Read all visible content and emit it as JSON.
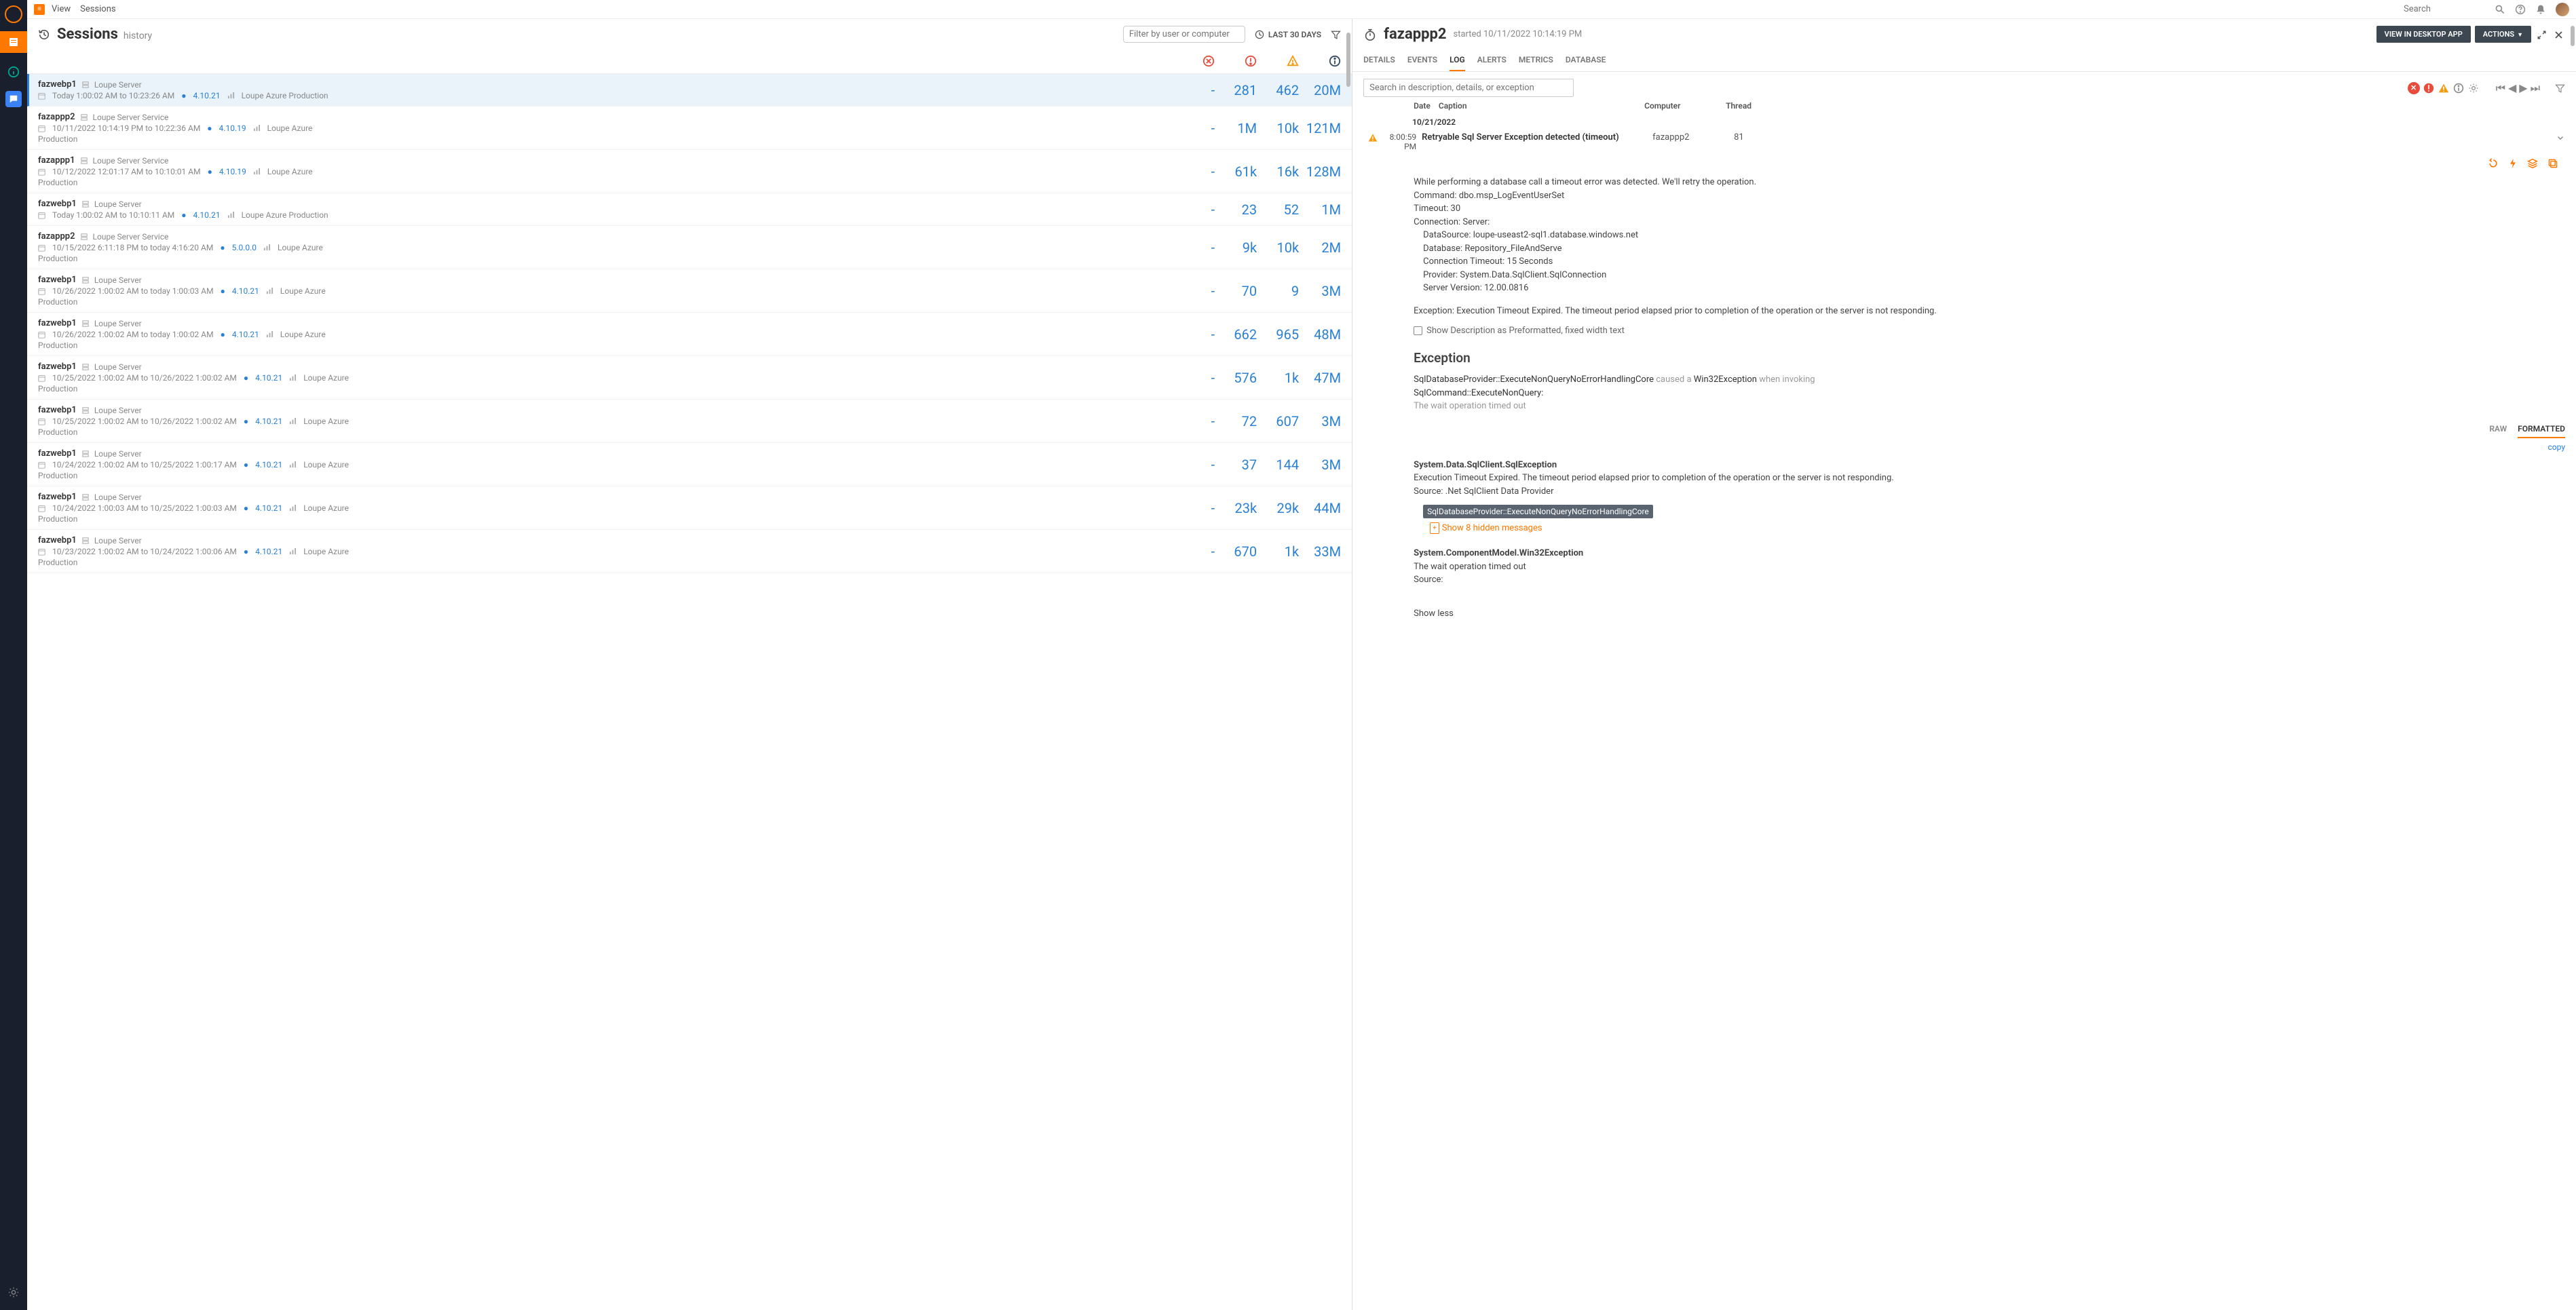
{
  "topbar": {
    "menu": [
      "View",
      "Sessions"
    ],
    "search_placeholder": "Search"
  },
  "sessions_header": {
    "title": "Sessions",
    "subtitle": "history",
    "filter_placeholder": "Filter by user or computer",
    "timerange": "LAST 30 DAYS"
  },
  "sessions": [
    {
      "host": "fazwebp1",
      "app": "Loupe Server",
      "time": "Today 1:00:02 AM to 10:23:26 AM",
      "version": "4.10.21",
      "env": "Loupe Azure Production",
      "c1": "-",
      "c2": "281",
      "c3": "462",
      "c4": "20M",
      "selected": true,
      "wrap": false
    },
    {
      "host": "fazappp2",
      "app": "Loupe Server Service",
      "time": "10/11/2022 10:14:19 PM to 10:22:36 AM",
      "version": "4.10.19",
      "env": "Loupe Azure",
      "extra": "Production",
      "c1": "-",
      "c2": "1M",
      "c3": "10k",
      "c4": "121M",
      "wrap": true
    },
    {
      "host": "fazappp1",
      "app": "Loupe Server Service",
      "time": "10/12/2022 12:01:17 AM to 10:10:01 AM",
      "version": "4.10.19",
      "env": "Loupe Azure",
      "extra": "Production",
      "c1": "-",
      "c2": "61k",
      "c3": "16k",
      "c4": "128M",
      "wrap": true
    },
    {
      "host": "fazwebp1",
      "app": "Loupe Server",
      "time": "Today 1:00:02 AM to 10:10:11 AM",
      "version": "4.10.21",
      "env": "Loupe Azure Production",
      "c1": "-",
      "c2": "23",
      "c3": "52",
      "c4": "1M",
      "wrap": false
    },
    {
      "host": "fazappp2",
      "app": "Loupe Server Service",
      "time": "10/15/2022 6:11:18 PM to today 4:16:20 AM",
      "version": "5.0.0.0",
      "env": "Loupe Azure",
      "extra": "Production",
      "c1": "-",
      "c2": "9k",
      "c3": "10k",
      "c4": "2M",
      "wrap": true
    },
    {
      "host": "fazwebp1",
      "app": "Loupe Server",
      "time": "10/26/2022 1:00:02 AM to today 1:00:03 AM",
      "version": "4.10.21",
      "env": "Loupe Azure",
      "extra": "Production",
      "c1": "-",
      "c2": "70",
      "c3": "9",
      "c4": "3M",
      "wrap": true
    },
    {
      "host": "fazwebp1",
      "app": "Loupe Server",
      "time": "10/26/2022 1:00:02 AM to today 1:00:02 AM",
      "version": "4.10.21",
      "env": "Loupe Azure",
      "extra": "Production",
      "c1": "-",
      "c2": "662",
      "c3": "965",
      "c4": "48M",
      "wrap": true
    },
    {
      "host": "fazwebp1",
      "app": "Loupe Server",
      "time": "10/25/2022 1:00:02 AM to 10/26/2022 1:00:02 AM",
      "version": "4.10.21",
      "env": "Loupe Azure",
      "extra": "Production",
      "c1": "-",
      "c2": "576",
      "c3": "1k",
      "c4": "47M",
      "wrap": true
    },
    {
      "host": "fazwebp1",
      "app": "Loupe Server",
      "time": "10/25/2022 1:00:02 AM to 10/26/2022 1:00:02 AM",
      "version": "4.10.21",
      "env": "Loupe Azure",
      "extra": "Production",
      "c1": "-",
      "c2": "72",
      "c3": "607",
      "c4": "3M",
      "wrap": true
    },
    {
      "host": "fazwebp1",
      "app": "Loupe Server",
      "time": "10/24/2022 1:00:02 AM to 10/25/2022 1:00:17 AM",
      "version": "4.10.21",
      "env": "Loupe Azure",
      "extra": "Production",
      "c1": "-",
      "c2": "37",
      "c3": "144",
      "c4": "3M",
      "wrap": true
    },
    {
      "host": "fazwebp1",
      "app": "Loupe Server",
      "time": "10/24/2022 1:00:03 AM to 10/25/2022 1:00:03 AM",
      "version": "4.10.21",
      "env": "Loupe Azure",
      "extra": "Production",
      "c1": "-",
      "c2": "23k",
      "c3": "29k",
      "c4": "44M",
      "wrap": true
    },
    {
      "host": "fazwebp1",
      "app": "Loupe Server",
      "time": "10/23/2022 1:00:02 AM to 10/24/2022 1:00:06 AM",
      "version": "4.10.21",
      "env": "Loupe Azure",
      "extra": "Production",
      "c1": "-",
      "c2": "670",
      "c3": "1k",
      "c4": "33M",
      "wrap": true
    }
  ],
  "detail": {
    "title": "fazappp2",
    "started": "started 10/11/2022 10:14:19 PM",
    "view_desktop": "VIEW IN DESKTOP APP",
    "actions": "ACTIONS",
    "tabs": [
      "DETAILS",
      "EVENTS",
      "LOG",
      "ALERTS",
      "METRICS",
      "DATABASE"
    ],
    "active_tab": "LOG",
    "search_placeholder": "Search in description, details, or exception",
    "col_date": "Date",
    "col_caption": "Caption",
    "col_computer": "Computer",
    "col_thread": "Thread",
    "date_group": "10/21/2022",
    "entry": {
      "time": "8:00:59 PM",
      "caption": "Retryable Sql Server Exception detected (timeout)",
      "computer": "fazappp2",
      "thread": "81"
    },
    "body": {
      "l1": "While performing a database call a timeout error was detected.  We'll retry the operation.",
      "l2": "Command: dbo.msp_LogEventUserSet",
      "l3": "Timeout: 30",
      "l4": "Connection: Server:",
      "l5": "DataSource: loupe-useast2-sql1.database.windows.net",
      "l6": "Database: Repository_FileAndServe",
      "l7": "Connection Timeout: 15 Seconds",
      "l8": "Provider: System.Data.SqlClient.SqlConnection",
      "l9": "Server Version: 12.00.0816",
      "l10": "Exception: Execution Timeout Expired.  The timeout period elapsed prior to completion of the operation or the server is not responding.",
      "show_preformatted": "Show Description as Preformatted, fixed width text"
    },
    "exception": {
      "heading": "Exception",
      "d1a": "SqlDatabaseProvider::ExecuteNonQueryNoErrorHandlingCore",
      "d1b": " caused a ",
      "d1c": "Win32Exception",
      "d1d": " when invoking ",
      "d2": "SqlCommand::ExecuteNonQuery:",
      "d3": "The wait operation timed out",
      "fmt_raw": "RAW",
      "fmt_formatted": "FORMATTED",
      "copy": "copy",
      "s1_title": "System.Data.SqlClient.SqlException",
      "s1_l1": "Execution Timeout Expired. The timeout period elapsed prior to completion of the operation or the server is not responding.",
      "s1_l2": "Source: .Net SqlClient Data Provider",
      "s1_frame": "SqlDatabaseProvider::ExecuteNonQueryNoErrorHandlingCore",
      "show_hidden": "Show 8 hidden messages",
      "s2_title": "System.ComponentModel.Win32Exception",
      "s2_l1": "The wait operation timed out",
      "s2_l2": "Source:",
      "show_less": "Show less"
    }
  }
}
